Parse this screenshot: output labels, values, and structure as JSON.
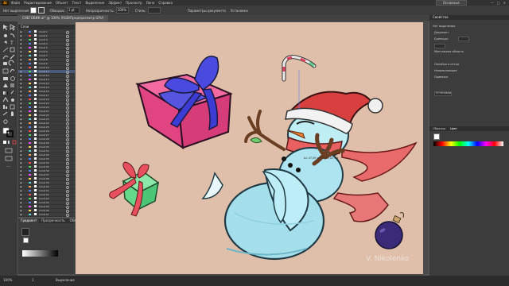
{
  "menubar": {
    "logo": "Ai",
    "items": [
      "Файл",
      "Редактирование",
      "Объект",
      "Текст",
      "Выделение",
      "Эффект",
      "Просмотр",
      "Окно",
      "Справка"
    ],
    "workspace": "Основные"
  },
  "controlbar": {
    "label_selection": "Нет выделения",
    "label_stroke": "Обводка:",
    "stroke_value": "1 pt",
    "label_opacity": "Непрозрачность:",
    "opacity_value": "100%",
    "label_style": "Стиль:",
    "label_doc_setup": "Параметры документа",
    "label_preferences": "Установки"
  },
  "document_tab": {
    "label": "СНЕГОВИК.ai* @ 100% (RGB/Предпросмотр GPU)"
  },
  "layers_panel": {
    "title": "Слои",
    "layers": [
      {
        "name": "Слой 1",
        "color": "#4f80ff"
      },
      {
        "name": "Слой 2",
        "color": "#ff4f4f"
      },
      {
        "name": "Слой 3",
        "color": "#4fd94f"
      },
      {
        "name": "Слой 4",
        "color": "#4f80ff"
      },
      {
        "name": "Слой 5",
        "color": "#ff4fff"
      },
      {
        "name": "Слой 6",
        "color": "#ffd24f"
      },
      {
        "name": "Слой 7",
        "color": "#4fd9d9"
      },
      {
        "name": "Слой 8",
        "color": "#ff9a4f"
      },
      {
        "name": "Слой 9",
        "color": "#4f80ff"
      },
      {
        "name": "Слой 10",
        "color": "#ff4f4f"
      },
      {
        "name": "Слой 11",
        "color": "#4fd94f"
      },
      {
        "name": "Слой 12",
        "color": "#4f80ff"
      },
      {
        "name": "Слой 13",
        "color": "#ff4fff"
      },
      {
        "name": "Слой 14",
        "color": "#ffd24f"
      },
      {
        "name": "Слой 15",
        "color": "#4fd9d9"
      },
      {
        "name": "Слой 16",
        "color": "#ff9a4f"
      },
      {
        "name": "Слой 17",
        "color": "#4f80ff"
      },
      {
        "name": "Слой 18",
        "color": "#ff4f4f"
      },
      {
        "name": "Слой 19",
        "color": "#4fd94f"
      },
      {
        "name": "Слой 20",
        "color": "#4f80ff"
      },
      {
        "name": "Слой 21",
        "color": "#ff4fff"
      },
      {
        "name": "Слой 22",
        "color": "#ffd24f"
      },
      {
        "name": "Слой 23",
        "color": "#4fd9d9"
      },
      {
        "name": "Слой 24",
        "color": "#ff9a4f"
      },
      {
        "name": "Слой 25",
        "color": "#4f80ff"
      },
      {
        "name": "Слой 26",
        "color": "#ff4f4f"
      },
      {
        "name": "Слой 27",
        "color": "#4fd94f"
      },
      {
        "name": "Слой 28",
        "color": "#4f80ff"
      },
      {
        "name": "Слой 29",
        "color": "#ff4fff"
      },
      {
        "name": "Слой 30",
        "color": "#ffd24f"
      },
      {
        "name": "Слой 31",
        "color": "#4fd9d9"
      },
      {
        "name": "Слой 32",
        "color": "#ff9a4f"
      },
      {
        "name": "Слой 33",
        "color": "#4f80ff"
      },
      {
        "name": "Слой 34",
        "color": "#ff4f4f"
      },
      {
        "name": "Слой 35",
        "color": "#4fd94f"
      },
      {
        "name": "Слой 36",
        "color": "#4f80ff"
      },
      {
        "name": "Слой 37",
        "color": "#ff4fff"
      },
      {
        "name": "Слой 38",
        "color": "#ffd24f"
      },
      {
        "name": "Слой 39",
        "color": "#4fd9d9"
      },
      {
        "name": "Слой 40",
        "color": "#ff9a4f"
      },
      {
        "name": "Слой 41",
        "color": "#4f80ff"
      },
      {
        "name": "Слой 42",
        "color": "#ff4f4f"
      },
      {
        "name": "Слой 43",
        "color": "#4fd94f"
      },
      {
        "name": "Слой 44",
        "color": "#4f80ff"
      },
      {
        "name": "Слой 45",
        "color": "#ff4fff"
      },
      {
        "name": "Слой 46",
        "color": "#ffd24f"
      },
      {
        "name": "Слой 47",
        "color": "#4fd9d9"
      }
    ]
  },
  "gradient_panel": {
    "tabs": [
      "Градиент",
      "Прозрачность",
      "Обводка"
    ]
  },
  "right_panel": {
    "title": "Свойства",
    "section_no_selection": "Нет выделения",
    "tab_document": "Документ",
    "label_units": "Единицы:",
    "label_artboard": "Монтажная область",
    "label_rulers": "Линейки и сетки",
    "label_guides": "Направляющие",
    "label_snap": "Привязка",
    "label_prefs_btn": "Установки",
    "color_panel_tabs": [
      "Образцы",
      "Цвет"
    ]
  },
  "canvas": {
    "background": "#dfbeaa",
    "watermark": "V. Nikolenko",
    "measure_tip": "Ш: 47,69 мм\nВ: 15,02 мм"
  },
  "statusbar": {
    "zoom": "100%",
    "page": "1",
    "tool": "Выделение"
  }
}
